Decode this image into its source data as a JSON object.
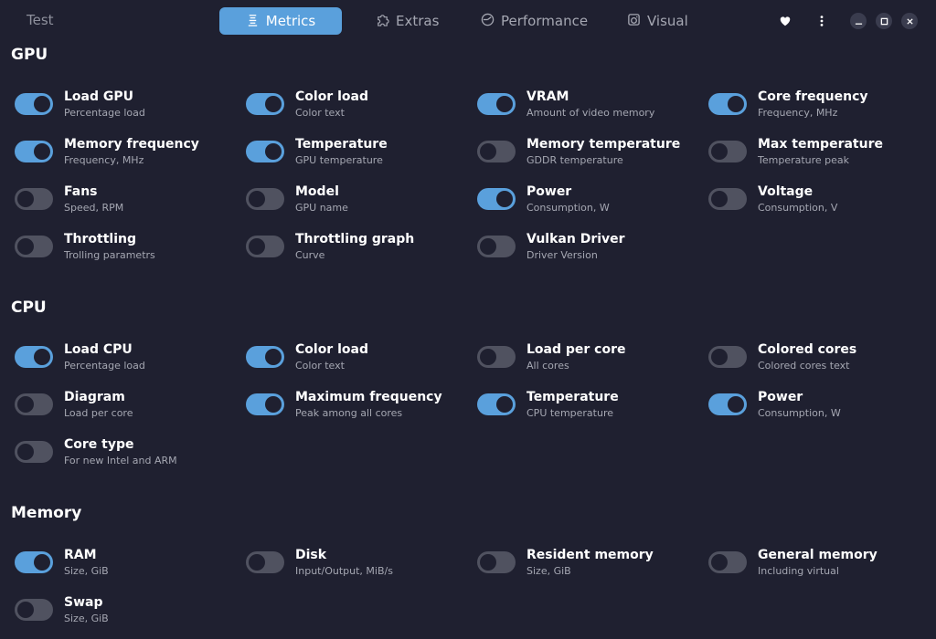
{
  "app": {
    "title": "Test"
  },
  "tabs": [
    {
      "label": "Metrics",
      "icon": "metrics-icon",
      "active": true
    },
    {
      "label": "Extras",
      "icon": "puzzle-icon",
      "active": false
    },
    {
      "label": "Performance",
      "icon": "speedometer-icon",
      "active": false
    },
    {
      "label": "Visual",
      "icon": "image-icon",
      "active": false
    }
  ],
  "header_buttons": [
    "heart-icon",
    "more-vertical-icon",
    "minimize-icon",
    "maximize-icon",
    "close-icon"
  ],
  "colors": {
    "accent": "#5aa0dc",
    "background": "#1f2030",
    "toggle_off": "#505260"
  },
  "sections": [
    {
      "title": "GPU",
      "items": [
        {
          "label": "Load GPU",
          "sub": "Percentage load",
          "on": true
        },
        {
          "label": "Color load",
          "sub": "Color text",
          "on": true
        },
        {
          "label": "VRAM",
          "sub": "Amount of video memory",
          "on": true
        },
        {
          "label": "Core frequency",
          "sub": "Frequency, MHz",
          "on": true
        },
        {
          "label": "Memory frequency",
          "sub": "Frequency, MHz",
          "on": true
        },
        {
          "label": "Temperature",
          "sub": "GPU temperature",
          "on": true
        },
        {
          "label": "Memory temperature",
          "sub": "GDDR temperature",
          "on": false
        },
        {
          "label": "Max temperature",
          "sub": "Temperature peak",
          "on": false
        },
        {
          "label": "Fans",
          "sub": "Speed, RPM",
          "on": false
        },
        {
          "label": "Model",
          "sub": "GPU name",
          "on": false
        },
        {
          "label": "Power",
          "sub": "Consumption, W",
          "on": true
        },
        {
          "label": "Voltage",
          "sub": "Consumption, V",
          "on": false
        },
        {
          "label": "Throttling",
          "sub": "Trolling parametrs",
          "on": false
        },
        {
          "label": "Throttling graph",
          "sub": "Curve",
          "on": false
        },
        {
          "label": "Vulkan Driver",
          "sub": "Driver Version",
          "on": false
        }
      ]
    },
    {
      "title": "CPU",
      "items": [
        {
          "label": "Load CPU",
          "sub": "Percentage load",
          "on": true
        },
        {
          "label": "Color load",
          "sub": "Color text",
          "on": true
        },
        {
          "label": "Load per core",
          "sub": "All cores",
          "on": false
        },
        {
          "label": "Colored cores",
          "sub": "Colored cores text",
          "on": false
        },
        {
          "label": "Diagram",
          "sub": "Load per core",
          "on": false
        },
        {
          "label": "Maximum frequency",
          "sub": "Peak among all cores",
          "on": true
        },
        {
          "label": "Temperature",
          "sub": "CPU temperature",
          "on": true
        },
        {
          "label": "Power",
          "sub": "Consumption, W",
          "on": true
        },
        {
          "label": "Core type",
          "sub": "For new Intel and ARM",
          "on": false
        }
      ]
    },
    {
      "title": "Memory",
      "items": [
        {
          "label": "RAM",
          "sub": "Size, GiB",
          "on": true
        },
        {
          "label": "Disk",
          "sub": "Input/Output, MiB/s",
          "on": false
        },
        {
          "label": "Resident memory",
          "sub": "Size, GiB",
          "on": false
        },
        {
          "label": "General memory",
          "sub": "Including virtual",
          "on": false
        },
        {
          "label": "Swap",
          "sub": "Size, GiB",
          "on": false
        }
      ]
    }
  ]
}
